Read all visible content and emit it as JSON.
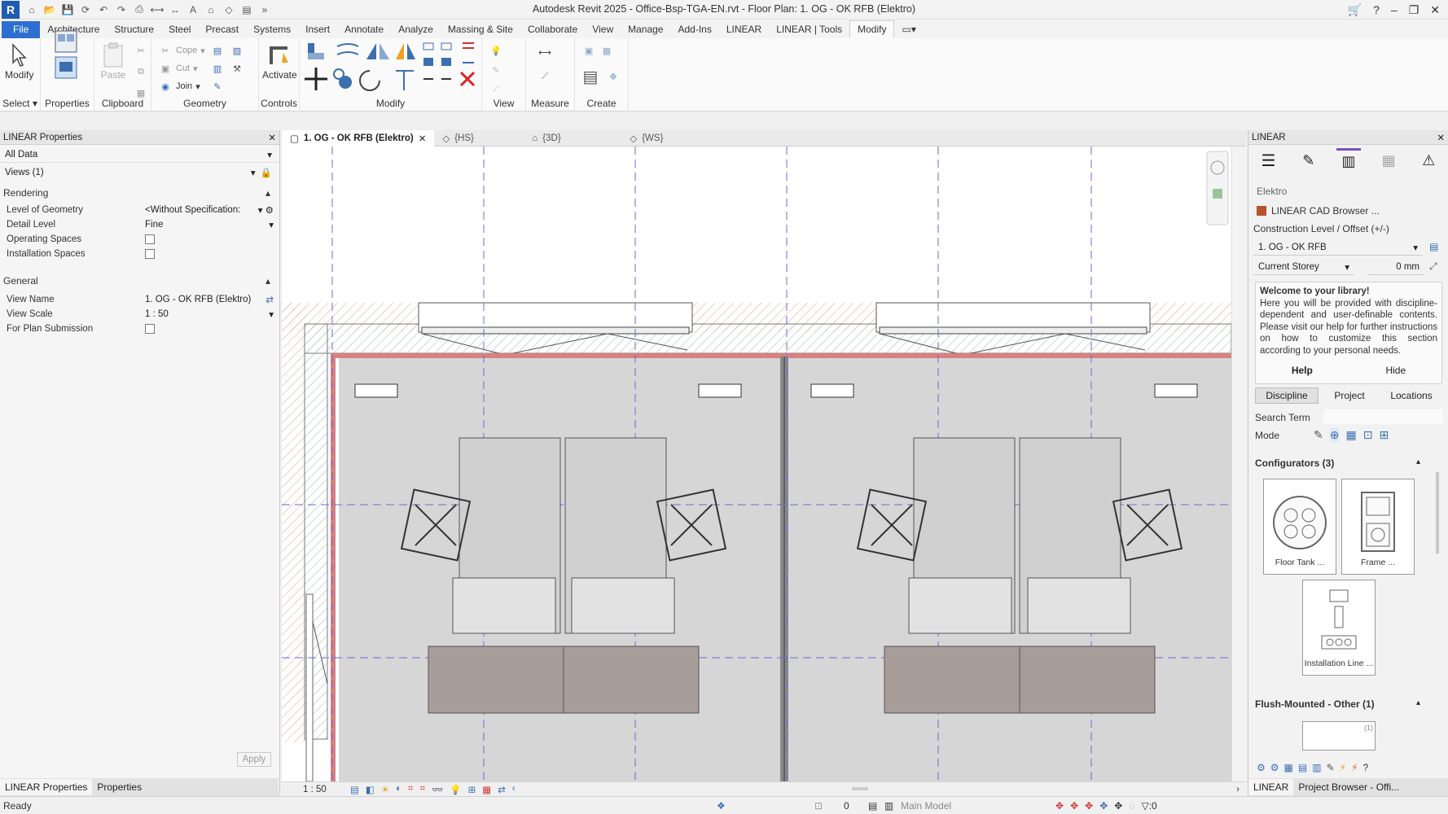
{
  "window": {
    "title": "Autodesk Revit 2025 - Office-Bsp-TGA-EN.rvt - Floor Plan: 1. OG - OK RFB (Elektro)",
    "logo": "R"
  },
  "menu": {
    "tabs": [
      "File",
      "Architecture",
      "Structure",
      "Steel",
      "Precast",
      "Systems",
      "Insert",
      "Annotate",
      "Analyze",
      "Massing & Site",
      "Collaborate",
      "View",
      "Manage",
      "Add-Ins",
      "LINEAR",
      "LINEAR | Tools",
      "Modify"
    ],
    "active": "Modify"
  },
  "ribbon": {
    "groups": {
      "select": "Select",
      "properties": "Properties",
      "clipboard": "Clipboard",
      "geometry": "Geometry",
      "controls": "Controls",
      "modify": "Modify",
      "view": "View",
      "measure": "Measure",
      "create": "Create"
    },
    "buttons": {
      "modify": "Modify",
      "paste": "Paste",
      "cope": "Cope",
      "cut": "Cut",
      "join": "Join",
      "activate": "Activate"
    }
  },
  "left_panel": {
    "title": "LINEAR Properties",
    "filter": "All Data",
    "views": "Views (1)",
    "sections": {
      "rendering": "Rendering",
      "general": "General"
    },
    "rendering_props": [
      {
        "key": "Level of Geometry",
        "value": "<Without Specification:"
      },
      {
        "key": "Detail Level",
        "value": "Fine"
      },
      {
        "key": "Operating Spaces",
        "value": ""
      },
      {
        "key": "Installation Spaces",
        "value": ""
      }
    ],
    "general_props": [
      {
        "key": "View Name",
        "value": "1. OG - OK RFB (Elektro)"
      },
      {
        "key": "View Scale",
        "value": "1 : 50"
      },
      {
        "key": "For Plan Submission",
        "value": ""
      }
    ],
    "apply": "Apply",
    "bottom_tabs": [
      "LINEAR Properties",
      "Properties"
    ]
  },
  "view_tabs": [
    {
      "label": "1. OG - OK RFB (Elektro)",
      "active": true
    },
    {
      "label": "{HS}",
      "active": false
    },
    {
      "label": "{3D}",
      "active": false
    },
    {
      "label": "{WS}",
      "active": false
    }
  ],
  "view_bar": {
    "scale": "1 : 50"
  },
  "right_panel": {
    "title": "LINEAR",
    "discipline": "Elektro",
    "browser_link": "LINEAR CAD Browser ...",
    "construction_label": "Construction Level / Offset (+/-)",
    "level": "1. OG - OK RFB",
    "storey": "Current Storey",
    "offset": "0 mm",
    "welcome_title": "Welcome to your library!",
    "welcome_text": "Here you will be provided with discipline-dependent and user-definable contents. Please visit our help for further instructions on how to customize this section according to your personal needs.",
    "help": "Help",
    "hide": "Hide",
    "tabs": [
      "Discipline",
      "Project",
      "Locations"
    ],
    "search_label": "Search Term",
    "mode_label": "Mode",
    "configurators": "Configurators (3)",
    "cards": [
      "Floor Tank ...",
      "Frame ...",
      "Installation Line ..."
    ],
    "flush_section": "Flush-Mounted - Other (1)",
    "flush_count": "(1)",
    "bottom_tabs": [
      "LINEAR",
      "Project Browser - Offi..."
    ]
  },
  "status": {
    "text": "Ready",
    "model": "Main Model",
    "count": "0",
    "filter_count": ":0"
  },
  "colors": {
    "file_tab": "#2d6fd0",
    "accent": "#7a4ec2",
    "wall_red": "#d98080",
    "hatch": "#e8a080",
    "grid": "#6a6ad8",
    "desk": "#a89c98"
  }
}
